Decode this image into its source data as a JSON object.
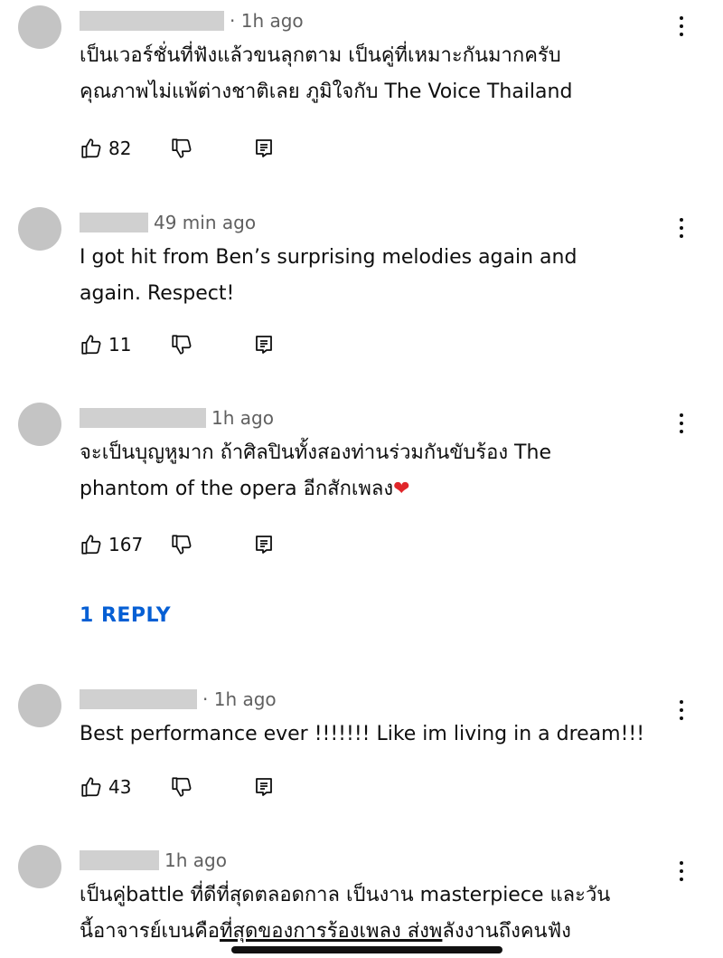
{
  "comments": [
    {
      "time": "· 1h ago",
      "lines": [
        "เป็นเวอร์ชั่นที่ฟังแล้วขนลุกตาม เป็นคู่ที่เหมาะกันมากครับ",
        "คุณภาพไม่แพ้ต่างชาติเลย  ภูมิใจกับ The Voice Thailand"
      ],
      "likes": "82"
    },
    {
      "time": "49 min ago",
      "lines": [
        "I got hit from Ben’s surprising melodies again and",
        "again. Respect!"
      ],
      "likes": "11"
    },
    {
      "time": "1h ago",
      "lines": [
        "จะเป็นบุญหูมาก ถ้าศิลปินทั้งสองท่านร่วมกันขับร้อง The",
        "phantom of the opera อีกสักเพลง"
      ],
      "heart": "❤",
      "likes": "167",
      "reply_label": "1 REPLY"
    },
    {
      "time": "· 1h ago",
      "lines": [
        "Best performance ever !!!!!!! Like im living in a dream!!!"
      ],
      "likes": "43"
    },
    {
      "time": "1h ago",
      "lines": [
        "เป็นคู่battle ที่ดีที่สุดตลอดกาล เป็นงาน masterpiece และวัน"
      ],
      "line2_a": "นี้อาจารย์เบนคือ",
      "line2_b": "ที่สุดของการร้องเพลง ส่งพ",
      "line2_c": "ลังงานถึงคนฟัง"
    }
  ],
  "icons": {
    "like": "thumb-up-icon",
    "dislike": "thumb-down-icon",
    "reply": "reply-comment-icon",
    "more": "more-vertical-icon"
  },
  "colors": {
    "link": "#065fd4",
    "avatar": "#c4c4c4",
    "heart": "#e0262a"
  }
}
